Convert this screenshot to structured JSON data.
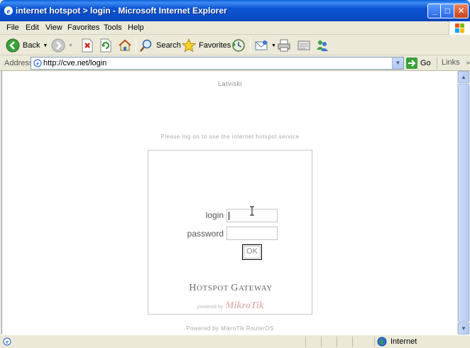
{
  "window": {
    "title": "internet hotspot > login - Microsoft Internet Explorer",
    "minimize": "_",
    "maximize": "□",
    "close": "✕"
  },
  "menu": [
    "File",
    "Edit",
    "View",
    "Favorites",
    "Tools",
    "Help"
  ],
  "toolbar": {
    "back_label": "Back",
    "search_label": "Search",
    "favorites_label": "Favorites"
  },
  "address": {
    "label": "Address",
    "url": "http://cve.net/login",
    "go_label": "Go",
    "links_label": "Links"
  },
  "page": {
    "language_link": "Latviski",
    "instruction": "Please log on to use the internet hotspot service",
    "login_label": "login",
    "login_value": "",
    "password_label": "password",
    "password_value": "",
    "ok_label": "OK",
    "gateway_title_h": "H",
    "gateway_title_1": "OTSPOT ",
    "gateway_title_g": "G",
    "gateway_title_2": "ATEWAY",
    "powered_by": "powered by",
    "brand": "MikroTik",
    "footer": "Powered by MikroTik RouterOS"
  },
  "status": {
    "zone": "Internet"
  },
  "colors": {
    "titlebar": "#0a53d3",
    "chrome": "#ece9d8",
    "mikrotik_brand": "#e3b9b9"
  }
}
